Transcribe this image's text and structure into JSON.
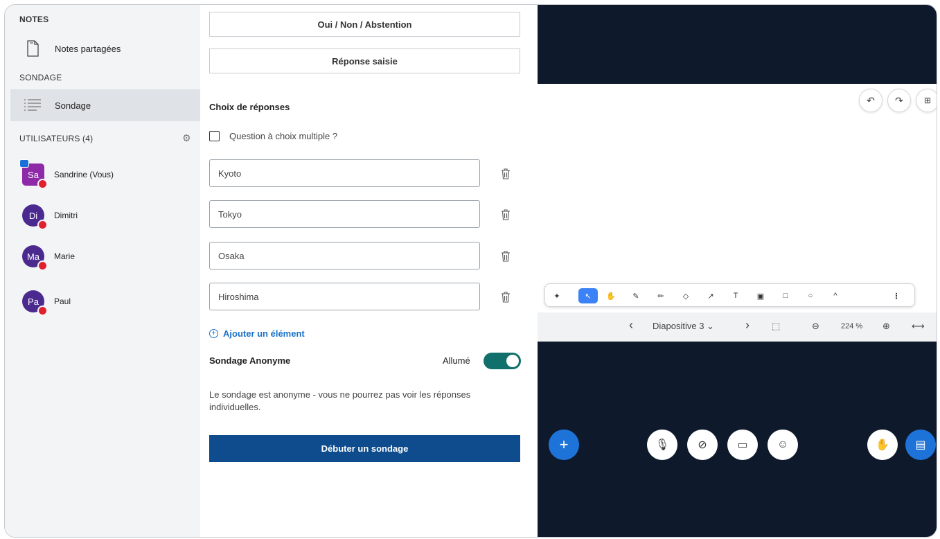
{
  "sidebar": {
    "notes_header": "NOTES",
    "shared_notes_label": "Notes partagées",
    "poll_header": "SONDAGE",
    "poll_item_label": "Sondage",
    "users_header": "UTILISATEURS (4)",
    "users": [
      {
        "initials": "Sa",
        "name": "Sandrine (Vous)"
      },
      {
        "initials": "Di",
        "name": "Dimitri"
      },
      {
        "initials": "Ma",
        "name": "Marie"
      },
      {
        "initials": "Pa",
        "name": "Paul"
      }
    ]
  },
  "poll": {
    "option_yes_no_abstain": "Oui / Non / Abstention",
    "option_typed_response": "Réponse saisie",
    "answers_title": "Choix de réponses",
    "multi_choice_label": "Question à choix multiple ?",
    "answers": [
      "Kyoto",
      "Tokyo",
      "Osaka",
      "Hiroshima"
    ],
    "add_item_label": "Ajouter un élément",
    "anonymous_label": "Sondage Anonyme",
    "anonymous_state": "Allumé",
    "anonymous_note": "Le sondage est anonyme - vous ne pourrez pas voir les réponses individuelles.",
    "start_button": "Débuter un sondage"
  },
  "presentation": {
    "slide_label": "Diapositive 3",
    "zoom": "224 %"
  },
  "colors": {
    "primary": "#0e4c8d",
    "toggle_on": "#11706b",
    "presentation_bg": "#0e1a2b",
    "accent_blue": "#1e73d8"
  }
}
